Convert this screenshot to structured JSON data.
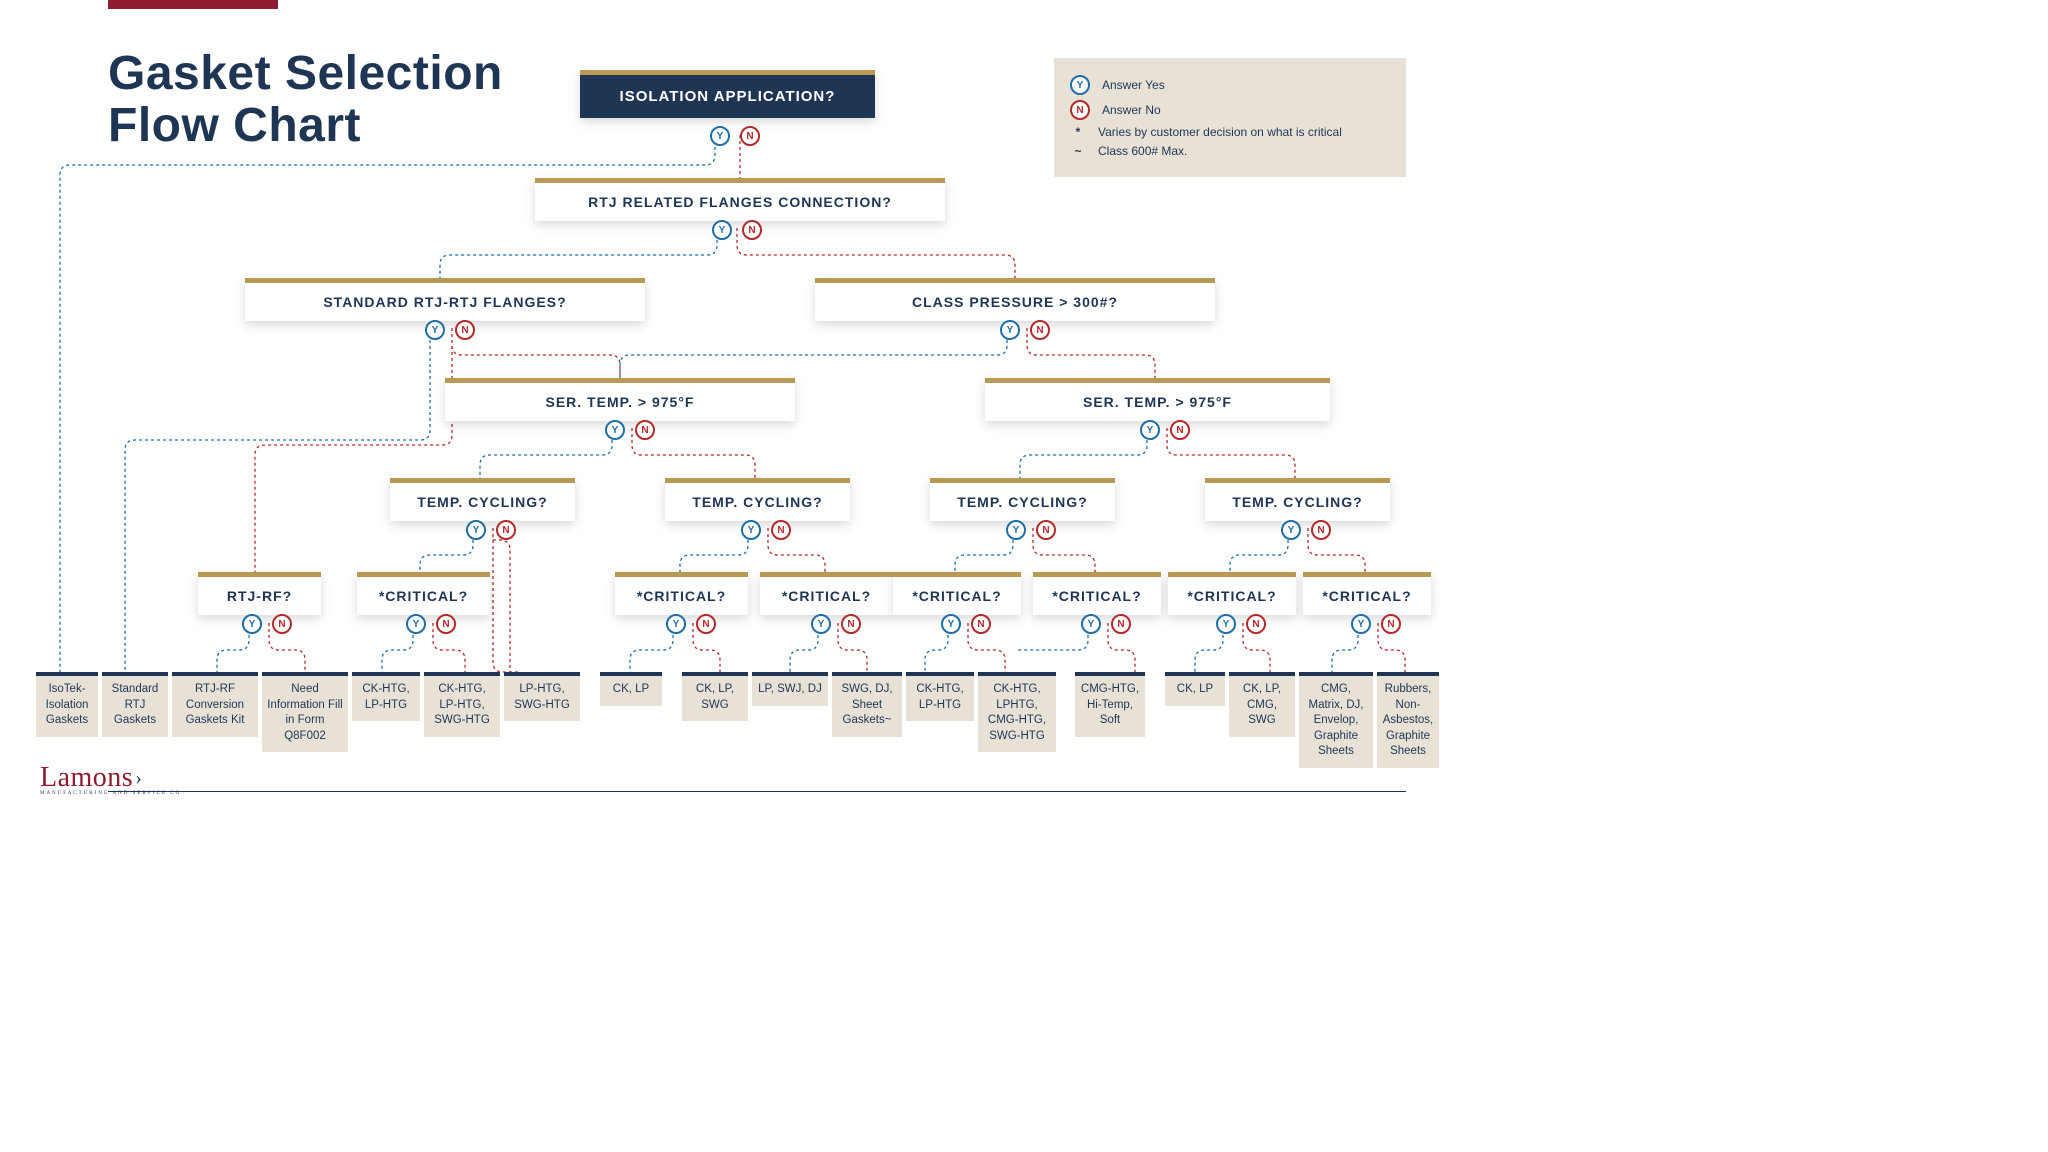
{
  "title_l1": "Gasket Selection",
  "title_l2": "Flow Chart",
  "legend": {
    "yes": "Answer Yes",
    "no": "Answer No",
    "star": "Varies by customer decision on what is critical",
    "tilde": "Class 600# Max."
  },
  "q": {
    "root": "ISOLATION APPLICATION?",
    "rtj_related": "RTJ RELATED FLANGES CONNECTION?",
    "std_rtj": "STANDARD RTJ-RTJ FLANGES?",
    "class_pressure": "CLASS PRESSURE > 300#?",
    "temp_a": "SER. TEMP. > 975°F",
    "temp_b": "SER. TEMP. > 975°F",
    "cyc1": "TEMP. CYCLING?",
    "cyc2": "TEMP. CYCLING?",
    "cyc3": "TEMP. CYCLING?",
    "cyc4": "TEMP. CYCLING?",
    "rtjrf": "RTJ-RF?",
    "crit1": "*CRITICAL?",
    "crit2": "*CRITICAL?",
    "crit3": "*CRITICAL?",
    "crit4": "*CRITICAL?",
    "crit5": "*CRITICAL?",
    "crit6": "*CRITICAL?",
    "crit7": "*CRITICAL?"
  },
  "results": [
    "IsoTek-Isolation Gaskets",
    "Standard RTJ Gaskets",
    "RTJ-RF Conversion Gaskets Kit",
    "Need Information Fill in Form Q8F002",
    "CK-HTG, LP-HTG",
    "CK-HTG, LP-HTG, SWG-HTG",
    "LP-HTG, SWG-HTG",
    "CK, LP",
    "CK, LP, SWG",
    "LP, SWJ, DJ",
    "SWG, DJ, Sheet Gaskets~",
    "CK-HTG, LP-HTG",
    "CK-HTG, LPHTG, CMG-HTG, SWG-HTG",
    "CMG-HTG, Hi-Temp, Soft",
    "CK, LP",
    "CK, LP, CMG, SWG",
    "CMG, Matrix, DJ, Envelop, Graphite Sheets",
    "Rubbers, Non-Asbestos, Graphite Sheets"
  ],
  "logo": {
    "name": "Lamons",
    "sub": "MANUFACTURING AND SERVICE CO"
  }
}
